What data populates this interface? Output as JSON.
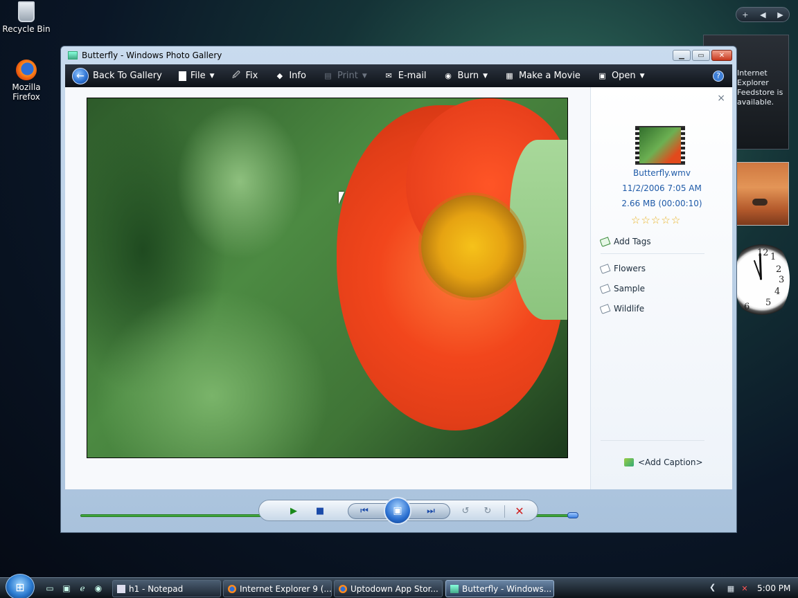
{
  "desktop": {
    "icons": [
      {
        "label": "Recycle Bin",
        "icon": "recycle-bin-icon"
      },
      {
        "label": "Mozilla Firefox",
        "icon": "firefox-icon"
      }
    ],
    "gadgets": {
      "controls": {
        "add": "+",
        "prev": "◀",
        "next": "▶"
      },
      "news_text": "Internet Explorer Feedstore is available.",
      "clock": {
        "n12": "12",
        "n1": "1",
        "n2": "2",
        "n3": "3",
        "n4": "4",
        "n5": "5",
        "n6": "6"
      }
    }
  },
  "window": {
    "title": "Butterfly - Windows Photo Gallery",
    "controls": {
      "minimize": "▁",
      "maximize": "▭",
      "close": "✕"
    },
    "toolbar": {
      "back": "Back To Gallery",
      "file": "File",
      "fix": "Fix",
      "info": "Info",
      "print": "Print",
      "email": "E-mail",
      "burn": "Burn",
      "make_movie": "Make a Movie",
      "open": "Open",
      "help": "?"
    },
    "media": {
      "progress_fraction": 1.0
    },
    "info_pane": {
      "close": "×",
      "filename": "Butterfly.wmv",
      "datetime": "11/2/2006   7:05 AM",
      "size_duration": "2.66 MB (00:00:10)",
      "rating": 0,
      "add_tags": "Add Tags",
      "tags": [
        "Flowers",
        "Sample",
        "Wildlife"
      ],
      "add_caption": "<Add Caption>"
    },
    "playback": {
      "play": "▶",
      "stop": "■",
      "prev": "⏮",
      "slideshow": "▣",
      "next": "⏭",
      "rotate_left": "↺",
      "rotate_right": "↻",
      "delete": "✕"
    }
  },
  "taskbar": {
    "start": "⊞",
    "tasks": [
      {
        "label": "h1 - Notepad"
      },
      {
        "label": "Internet Explorer 9 (..."
      },
      {
        "label": "Uptodown App Stor..."
      },
      {
        "label": "Butterfly - Windows..."
      }
    ],
    "tray_arrow": "❮",
    "time": "5:00 PM"
  }
}
